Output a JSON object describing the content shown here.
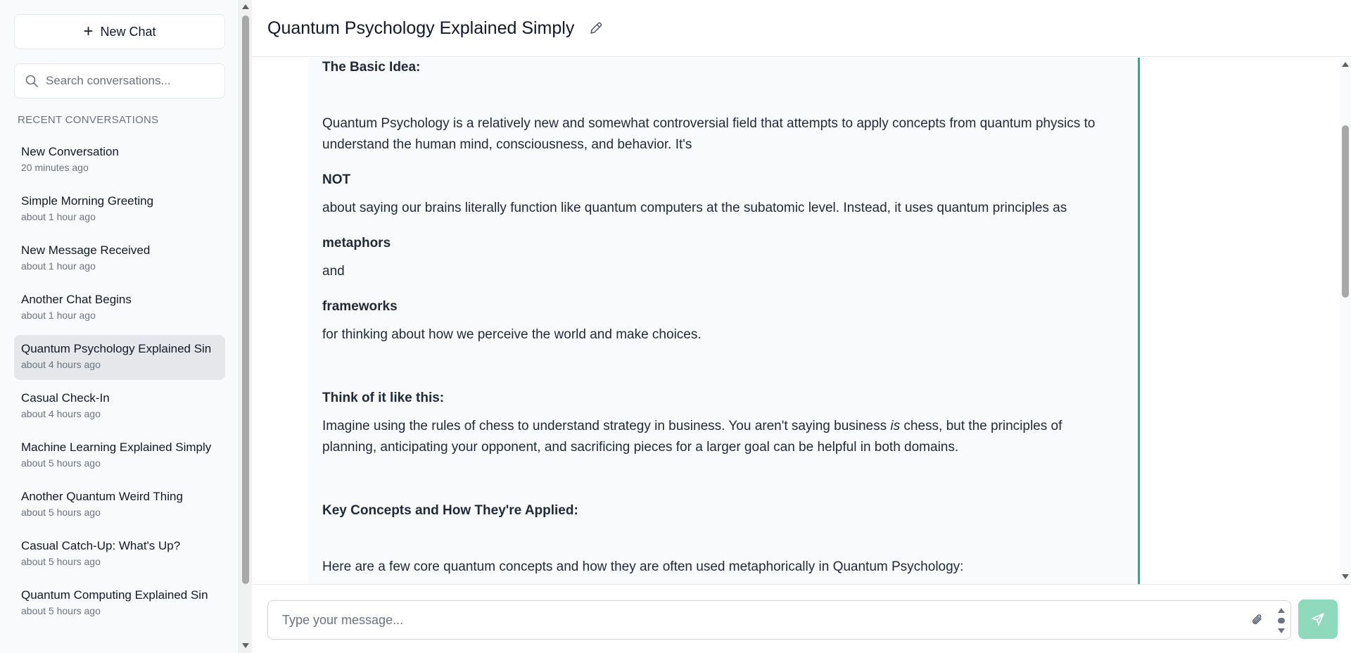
{
  "sidebar": {
    "new_chat_label": "New Chat",
    "search_placeholder": "Search conversations...",
    "section_label": "RECENT CONVERSATIONS",
    "conversations": [
      {
        "title": "New Conversation",
        "time": "20 minutes ago"
      },
      {
        "title": "Simple Morning Greeting",
        "time": "about 1 hour ago"
      },
      {
        "title": "New Message Received",
        "time": "about 1 hour ago"
      },
      {
        "title": "Another Chat Begins",
        "time": "about 1 hour ago"
      },
      {
        "title": "Quantum Psychology Explained Sin",
        "time": "about 4 hours ago"
      },
      {
        "title": "Casual Check-In",
        "time": "about 4 hours ago"
      },
      {
        "title": "Machine Learning Explained Simply",
        "time": "about 5 hours ago"
      },
      {
        "title": "Another Quantum Weird Thing",
        "time": "about 5 hours ago"
      },
      {
        "title": "Casual Catch-Up: What's Up?",
        "time": "about 5 hours ago"
      },
      {
        "title": "Quantum Computing Explained Sin",
        "time": "about 5 hours ago"
      }
    ],
    "active_index": 4
  },
  "header": {
    "title": "Quantum Psychology Explained Simply"
  },
  "message": {
    "basic_idea_heading": "The Basic Idea:",
    "para1_line1": "Quantum Psychology is a relatively new and somewhat controversial field that attempts to apply concepts from quantum physics to",
    "para1_line2": "understand the human mind, consciousness, and behavior. It's",
    "not_word": "NOT",
    "para2": " about saying our brains literally function like quantum computers at the subatomic level. Instead, it uses quantum principles as",
    "metaphors_word": "metaphors",
    "and_word": " and",
    "frameworks_word": "frameworks",
    "para3": " for thinking about how we perceive the world and make choices.",
    "think_heading": "Think of it like this:",
    "think_line1_before": " Imagine using the rules of chess to understand strategy in business.  You aren't saying business ",
    "think_line1_italic": "is",
    "think_line1_after": " chess, but the principles of",
    "think_line2": "planning, anticipating your opponent, and sacrificing pieces for a larger goal can be helpful in both domains.",
    "key_heading": "Key Concepts and How They're Applied:",
    "key_para": "Here are a few core quantum concepts and how they are often used metaphorically in Quantum Psychology:"
  },
  "input": {
    "placeholder": "Type your message..."
  },
  "colors": {
    "accent": "#10b981",
    "send_button": "#8fd9bd",
    "active_item": "#e5e7eb"
  }
}
